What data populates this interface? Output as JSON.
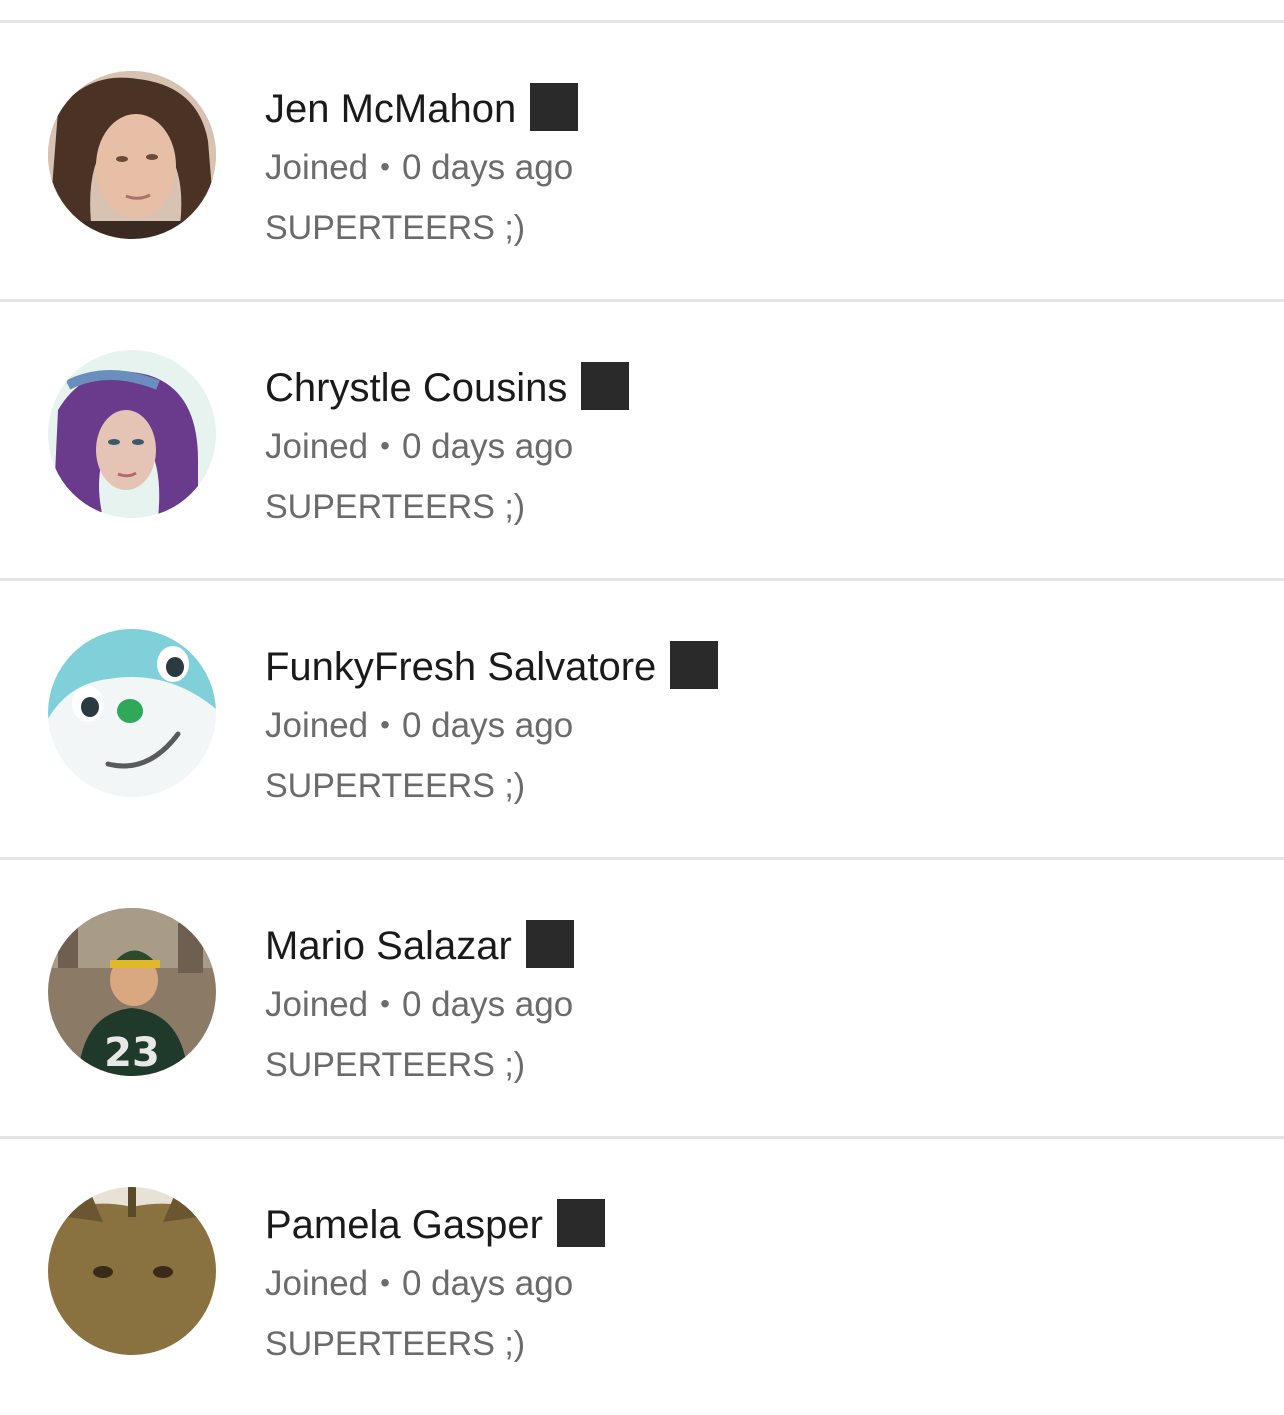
{
  "members": [
    {
      "name": "Jen McMahon",
      "joined_label": "Joined",
      "separator": "•",
      "joined_when": "0 days ago",
      "tag": "SUPERTEERS ;)",
      "avatar": "woman-brown-hair-photo"
    },
    {
      "name": "Chrystle Cousins",
      "joined_label": "Joined",
      "separator": "•",
      "joined_when": "0 days ago",
      "tag": "SUPERTEERS ;)",
      "avatar": "woman-purple-hair-photo"
    },
    {
      "name": "FunkyFresh Salvatore",
      "joined_label": "Joined",
      "separator": "•",
      "joined_when": "0 days ago",
      "tag": "SUPERTEERS ;)",
      "avatar": "cartoon-seal-photo"
    },
    {
      "name": "Mario Salazar",
      "joined_label": "Joined",
      "separator": "•",
      "joined_when": "0 days ago",
      "tag": "SUPERTEERS ;)",
      "avatar": "man-jersey-23-photo"
    },
    {
      "name": "Pamela Gasper",
      "joined_label": "Joined",
      "separator": "•",
      "joined_when": "0 days ago",
      "tag": "SUPERTEERS ;)",
      "avatar": "cat-photo"
    }
  ],
  "colors": {
    "divider": "#e4e4e4",
    "name_text": "#1a1a1a",
    "meta_text": "#6b6b6b",
    "badge": "#2a2a2a"
  }
}
